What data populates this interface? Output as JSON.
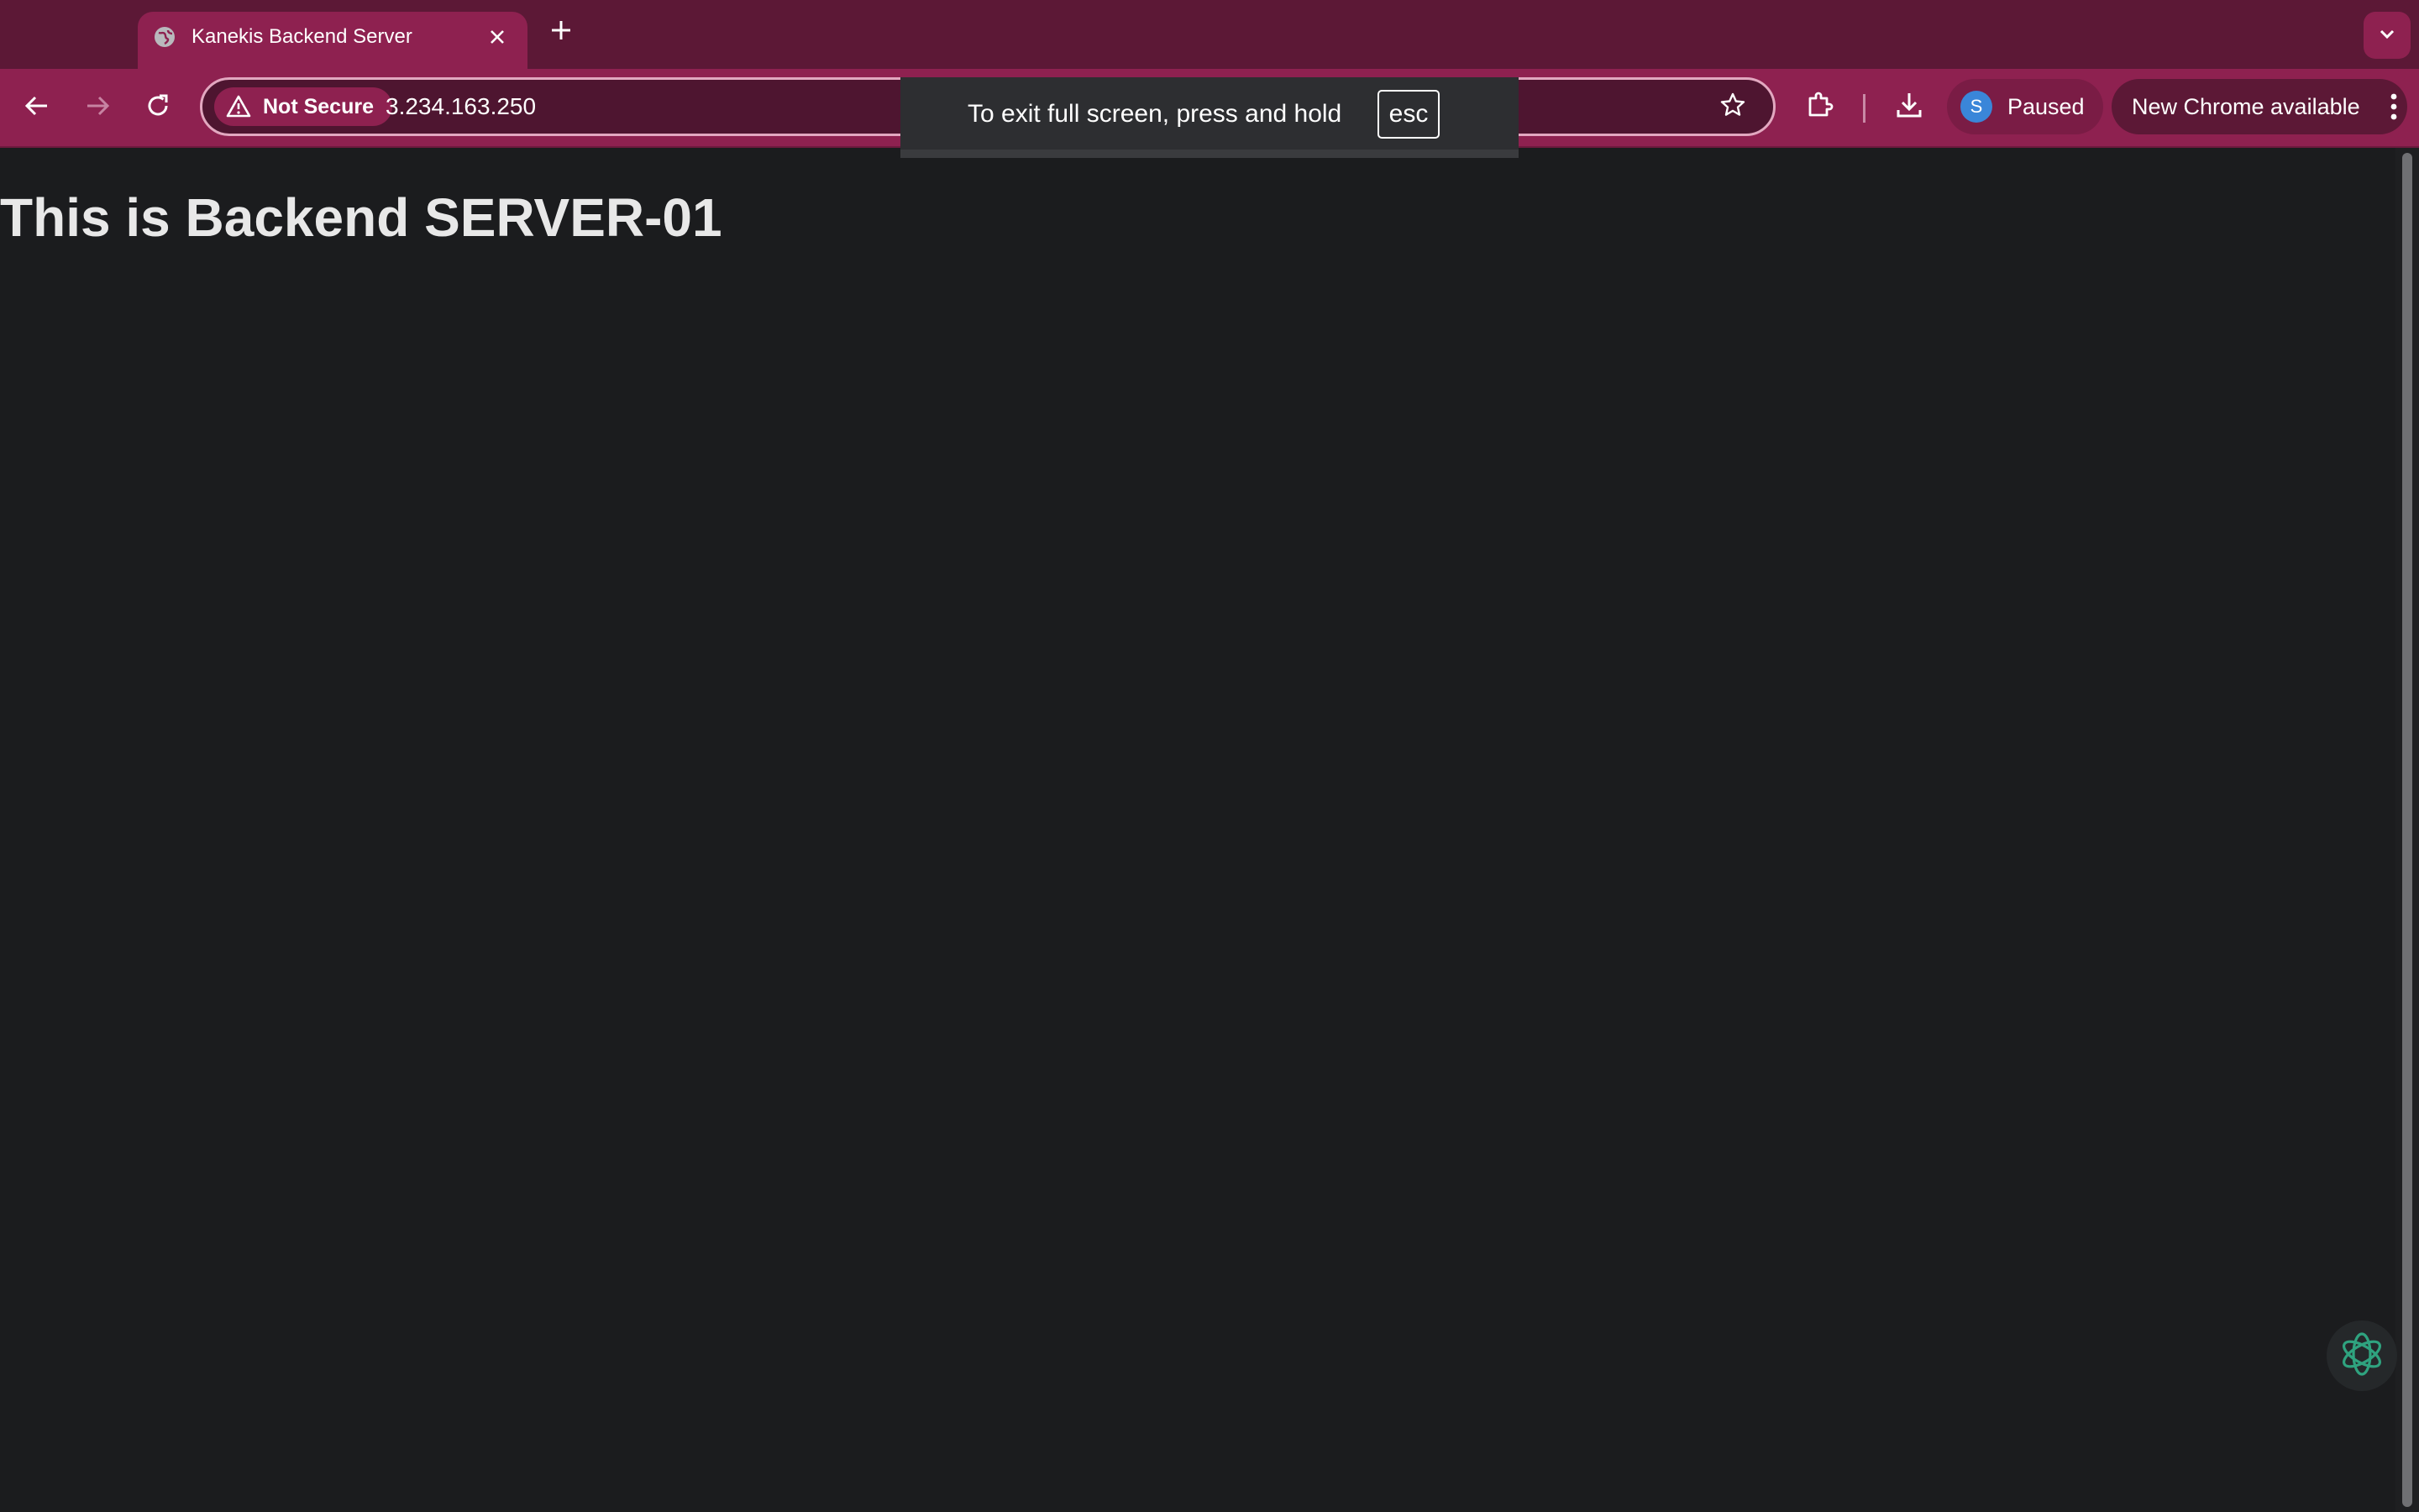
{
  "browser": {
    "tab": {
      "title": "Kanekis Backend Server",
      "favicon": "globe-icon"
    },
    "address_bar": {
      "security_label": "Not Secure",
      "url": "3.234.163.250"
    },
    "profile": {
      "initial": "S",
      "status": "Paused"
    },
    "update_button": {
      "label": "New Chrome available"
    },
    "fullscreen_notice": {
      "text": "To exit full screen, press and hold",
      "key": "esc"
    },
    "colors": {
      "frame": "#5c1836",
      "toolbar": "#8e2150",
      "page_bg": "#1b1c1e",
      "avatar": "#3a86d9",
      "assistant": "#2fa37f"
    }
  },
  "page": {
    "heading": "This is Backend SERVER-01"
  },
  "icons": [
    "globe-icon",
    "close-icon",
    "plus-icon",
    "chevron-down-icon",
    "back-arrow-icon",
    "forward-arrow-icon",
    "reload-icon",
    "warning-icon",
    "star-icon",
    "extensions-icon",
    "download-icon",
    "more-vert-icon",
    "openai-logo-icon"
  ]
}
